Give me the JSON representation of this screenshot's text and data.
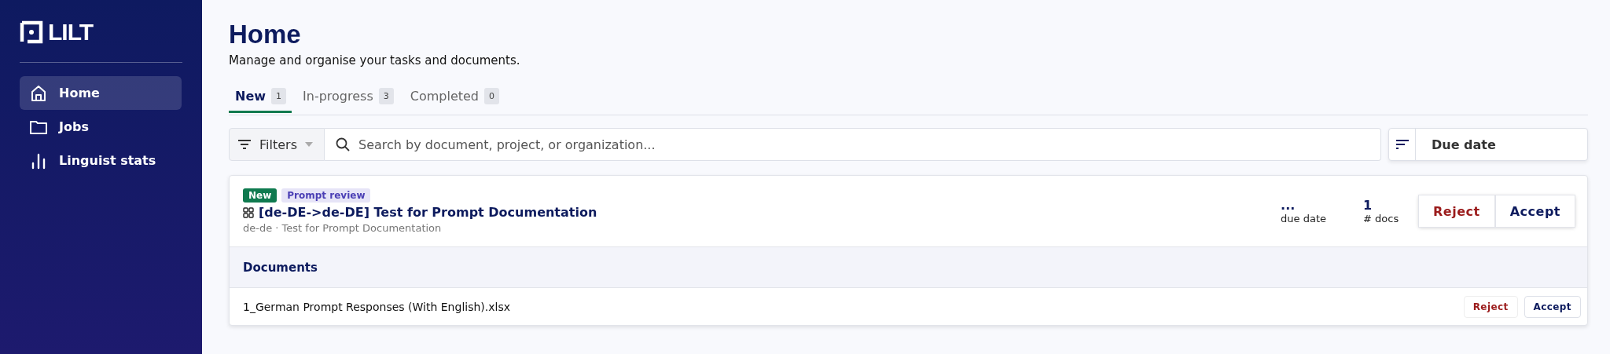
{
  "sidebar": {
    "logo": "LILT",
    "items": [
      {
        "label": "Home",
        "selected": true
      },
      {
        "label": "Jobs",
        "selected": false
      },
      {
        "label": "Linguist stats",
        "selected": false
      }
    ]
  },
  "header": {
    "title": "Home",
    "subtitle": "Manage and organise your tasks and documents."
  },
  "tabs": [
    {
      "label": "New",
      "count": "1",
      "selected": true
    },
    {
      "label": "In-progress",
      "count": "3",
      "selected": false
    },
    {
      "label": "Completed",
      "count": "0",
      "selected": false
    }
  ],
  "toolbar": {
    "filters": "Filters",
    "search": {
      "placeholder": "Search by document, project, or organization..."
    },
    "sort": "Due date"
  },
  "job": {
    "status_badge": "New",
    "type_badge": "Prompt review",
    "title": "[de-DE->de-DE] Test for Prompt Documentation",
    "subtitle": "de-de · Test for Prompt Documentation",
    "due_date": {
      "value": "...",
      "label": "due date"
    },
    "docs": {
      "value": "1",
      "label": "# docs"
    },
    "reject": "Reject",
    "accept": "Accept",
    "documents_heading": "Documents",
    "documents": [
      {
        "name": "1_German Prompt Responses (With English).xlsx",
        "reject": "Reject",
        "accept": "Accept"
      }
    ]
  }
}
